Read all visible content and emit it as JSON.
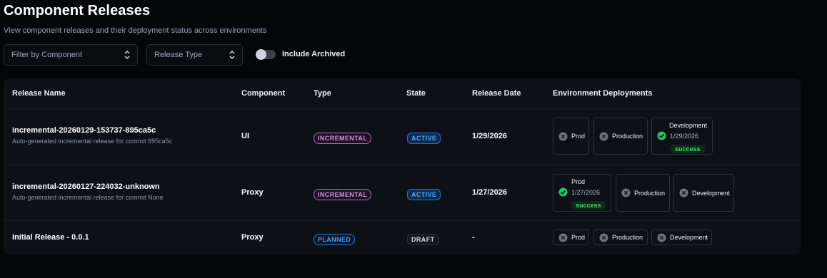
{
  "page": {
    "title": "Component Releases",
    "subtitle": "View component releases and their deployment status across environments"
  },
  "filters": {
    "component_placeholder": "Filter by Component",
    "type_placeholder": "Release Type",
    "archived_label": "Include Archived",
    "archived_on": false
  },
  "table": {
    "headers": [
      "Release Name",
      "Component",
      "Type",
      "State",
      "Release Date",
      "Environment Deployments"
    ],
    "rows": [
      {
        "name": "incremental-20260129-153737-895ca5c",
        "description": "Auto-generated incremental release for commit 895ca5c",
        "component": "UI",
        "type": "INCREMENTAL",
        "state": "ACTIVE",
        "date": "1/29/2026",
        "envs": [
          {
            "name": "Prod",
            "status": "not-deployed"
          },
          {
            "name": "Production",
            "status": "not-deployed"
          },
          {
            "name": "Development",
            "status": "success",
            "date": "1/29/2026",
            "status_label": "success"
          }
        ]
      },
      {
        "name": "incremental-20260127-224032-unknown",
        "description": "Auto-generated incremental release for commit None",
        "component": "Proxy",
        "type": "INCREMENTAL",
        "state": "ACTIVE",
        "date": "1/27/2026",
        "envs": [
          {
            "name": "Prod",
            "status": "success",
            "date": "1/27/2026",
            "status_label": "success"
          },
          {
            "name": "Production",
            "status": "not-deployed"
          },
          {
            "name": "Development",
            "status": "not-deployed"
          }
        ]
      },
      {
        "name": "Initial Release - 0.0.1",
        "description": "",
        "component": "Proxy",
        "type": "PLANNED",
        "state": "DRAFT",
        "date": "-",
        "envs": [
          {
            "name": "Prod",
            "status": "not-deployed"
          },
          {
            "name": "Production",
            "status": "not-deployed"
          },
          {
            "name": "Development",
            "status": "not-deployed"
          }
        ]
      }
    ]
  },
  "icons": {
    "not_deployed": "x-circle-icon",
    "success": "check-circle-icon",
    "select": "chevron-up-down-icon"
  },
  "colors": {
    "background": "#050608",
    "card": "#0d1117",
    "success": "#3ddc6a",
    "active": "#52a8ff",
    "incremental": "#d98ae6",
    "planned": "#4a9cf5"
  }
}
